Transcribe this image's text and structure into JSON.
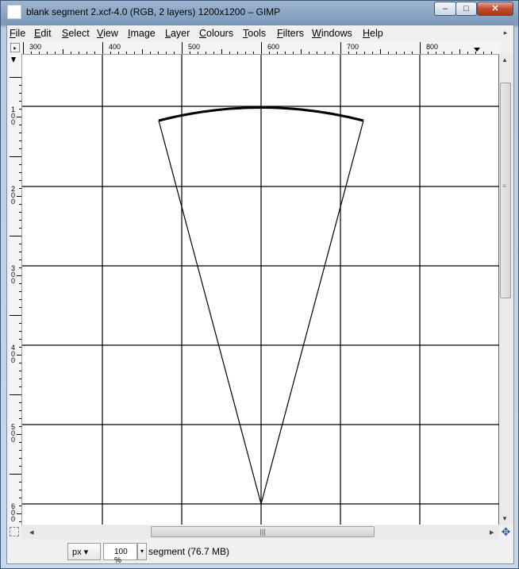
{
  "window": {
    "title": "blank segment 2.xcf-4.0 (RGB, 2 layers) 1200x1200 – GIMP",
    "min_glyph": "‒",
    "max_glyph": "□",
    "close_glyph": "✕"
  },
  "menubar": {
    "items": [
      "File",
      "Edit",
      "Select",
      "View",
      "Image",
      "Layer",
      "Colours",
      "Tools",
      "Filters",
      "Windows",
      "Help"
    ],
    "menu_arrow_glyph": "▸"
  },
  "rulers": {
    "horizontal_labels": [
      "300",
      "400",
      "500",
      "600",
      "700",
      "800"
    ],
    "vertical_labels": [
      "1\n0\n0",
      "2\n0\n0",
      "3\n0\n0",
      "4\n0\n0",
      "5\n0\n0",
      "6\n0\n0"
    ],
    "corner_glyph": "▸"
  },
  "scrollbars": {
    "up_glyph": "▲",
    "down_glyph": "▼",
    "left_glyph": "◂",
    "right_glyph": "▸",
    "grip_glyph": "|||"
  },
  "navigate_glyph": "✥",
  "statusbar": {
    "unit": "px",
    "unit_arrow": "▾",
    "zoom": "100 %",
    "zoom_arrow": "▾",
    "message": "segment (76.7 MB)"
  },
  "icons": {
    "app": "gimp-image-icon",
    "navigate": "navigate-icon",
    "quickmask": "quick-mask-icon"
  }
}
